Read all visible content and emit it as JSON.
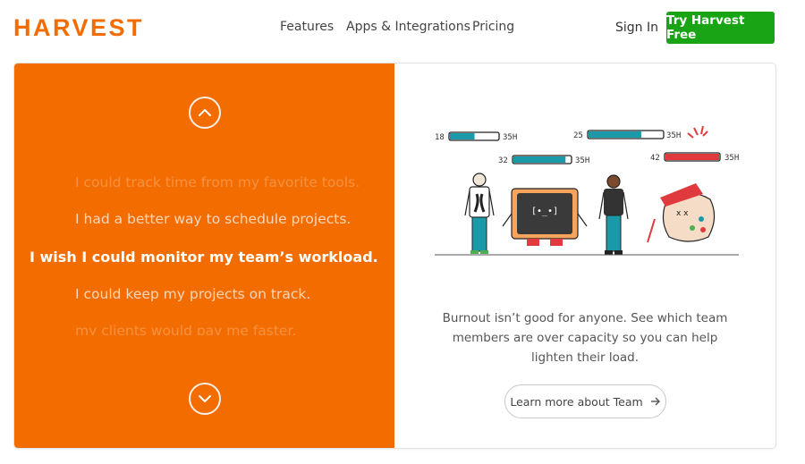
{
  "header": {
    "logo": "HARVEST",
    "nav": [
      "Features",
      "Apps & Integrations",
      "Pricing"
    ],
    "sign_in": "Sign In",
    "cta": "Try Harvest Free"
  },
  "rotator": {
    "phrases": [
      "I could track time from my favorite tools.",
      "I had a better way to schedule projects.",
      "I wish I could monitor my team’s workload.",
      "I could keep my projects on track.",
      "my clients would pay me faster."
    ],
    "active_index": 2
  },
  "illustration": {
    "bars": [
      {
        "value": "18",
        "max": "35H",
        "fill": 0.51
      },
      {
        "value": "25",
        "max": "35H",
        "fill": 0.71
      },
      {
        "value": "32",
        "max": "35H",
        "fill": 0.91
      },
      {
        "value": "42",
        "max": "35H",
        "fill": 1.2
      }
    ]
  },
  "team": {
    "description": "Burnout isn’t good for anyone. See which team members are over capacity so you can help lighten their load.",
    "button": "Learn more about Team"
  },
  "colors": {
    "brand_orange": "#f36c00",
    "cta_green": "#18a415",
    "bar_teal": "#1a9aa8",
    "bar_red": "#e03a3e"
  }
}
